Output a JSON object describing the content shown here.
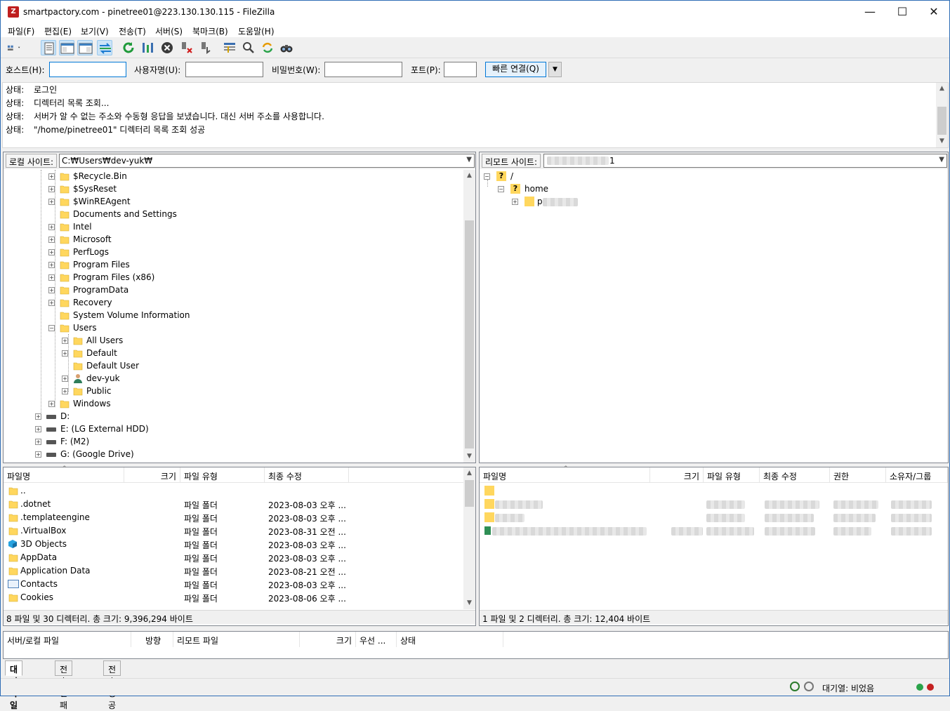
{
  "window": {
    "title": "smartpactory.com - pinetree01@223.130.130.115 - FileZilla",
    "app_icon": "Z",
    "controls": {
      "minimize": "—",
      "maximize": "☐",
      "close": "✕"
    }
  },
  "menu": [
    "파일(F)",
    "편집(E)",
    "보기(V)",
    "전송(T)",
    "서버(S)",
    "북마크(B)",
    "도움말(H)"
  ],
  "quickconnect": {
    "host_label": "호스트(H):",
    "host_value": "",
    "user_label": "사용자명(U):",
    "user_value": "",
    "pass_label": "비밀번호(W):",
    "pass_value": "",
    "port_label": "포트(P):",
    "port_value": "",
    "connect_button": "빠른 연결(Q)"
  },
  "log": [
    {
      "key": "상태:",
      "text": "로그인"
    },
    {
      "key": "상태:",
      "text": "디렉터리 목록 조회..."
    },
    {
      "key": "상태:",
      "text": "서버가 알 수 없는 주소와 수동형 응답을 보냈습니다. 대신 서버 주소를 사용합니다."
    },
    {
      "key": "상태:",
      "text": "\"/home/pinetree01\" 디렉터리 목록 조회 성공"
    }
  ],
  "local": {
    "site_label": "로컬 사이트:",
    "path": "C:₩Users₩dev-yuk₩",
    "tree": [
      {
        "name": "$Recycle.Bin",
        "exp": "+"
      },
      {
        "name": "$SysReset",
        "exp": "+"
      },
      {
        "name": "$WinREAgent",
        "exp": "+"
      },
      {
        "name": "Documents and Settings",
        "exp": ""
      },
      {
        "name": "Intel",
        "exp": "+"
      },
      {
        "name": "Microsoft",
        "exp": "+"
      },
      {
        "name": "PerfLogs",
        "exp": "+"
      },
      {
        "name": "Program Files",
        "exp": "+"
      },
      {
        "name": "Program Files (x86)",
        "exp": "+"
      },
      {
        "name": "ProgramData",
        "exp": "+"
      },
      {
        "name": "Recovery",
        "exp": "+"
      },
      {
        "name": "System Volume Information",
        "exp": ""
      },
      {
        "name": "Users",
        "exp": "−"
      }
    ],
    "users_children": [
      {
        "name": "All Users",
        "exp": "+"
      },
      {
        "name": "Default",
        "exp": "+"
      },
      {
        "name": "Default User",
        "exp": ""
      },
      {
        "name": "dev-yuk",
        "exp": "+",
        "user": true
      },
      {
        "name": "Public",
        "exp": "+"
      }
    ],
    "tree_after": [
      {
        "name": "Windows",
        "exp": "+"
      }
    ],
    "drives": [
      "D:",
      "E: (LG External HDD)",
      "F: (M2)",
      "G: (Google Drive)"
    ],
    "columns": [
      "파일명",
      "크기",
      "파일 유형",
      "최종 수정"
    ],
    "files": [
      {
        "name": "..",
        "type": "",
        "date": "",
        "icon": "folder"
      },
      {
        "name": ".dotnet",
        "type": "파일 폴더",
        "date": "2023-08-03 오후 ...",
        "icon": "folder"
      },
      {
        "name": ".templateengine",
        "type": "파일 폴더",
        "date": "2023-08-03 오후 ...",
        "icon": "folder"
      },
      {
        "name": ".VirtualBox",
        "type": "파일 폴더",
        "date": "2023-08-31 오전 ...",
        "icon": "folder"
      },
      {
        "name": "3D Objects",
        "type": "파일 폴더",
        "date": "2023-08-03 오후 ...",
        "icon": "cube"
      },
      {
        "name": "AppData",
        "type": "파일 폴더",
        "date": "2023-08-03 오후 ...",
        "icon": "folder"
      },
      {
        "name": "Application Data",
        "type": "파일 폴더",
        "date": "2023-08-21 오전 ...",
        "icon": "folder"
      },
      {
        "name": "Contacts",
        "type": "파일 폴더",
        "date": "2023-08-03 오후 ...",
        "icon": "contacts"
      },
      {
        "name": "Cookies",
        "type": "파일 폴더",
        "date": "2023-08-06 오후 ...",
        "icon": "folder"
      }
    ],
    "status": "8 파일 및 30 디렉터리. 총 크기: 9,396,294 바이트"
  },
  "remote": {
    "site_label": "리모트 사이트:",
    "path_suffix": "1",
    "tree_root": "/",
    "tree_home": "home",
    "tree_child_initial": "p",
    "columns": [
      "파일명",
      "크기",
      "파일 유형",
      "최종 수정",
      "권한",
      "소유자/그룹"
    ],
    "status": "1 파일 및 2 디렉터리. 총 크기: 12,404 바이트"
  },
  "queue": {
    "columns": [
      "서버/로컬 파일",
      "방향",
      "리모트 파일",
      "크기",
      "우선 ...",
      "상태"
    ],
    "tabs": [
      "대기 파일",
      "전송 실패",
      "전송 성공"
    ]
  },
  "statusbar": {
    "queue_text": "대기열: 비었음"
  },
  "colors": {
    "accent": "#0078d7",
    "folder": "#ffd75e",
    "title_border": "#2f6db5"
  }
}
